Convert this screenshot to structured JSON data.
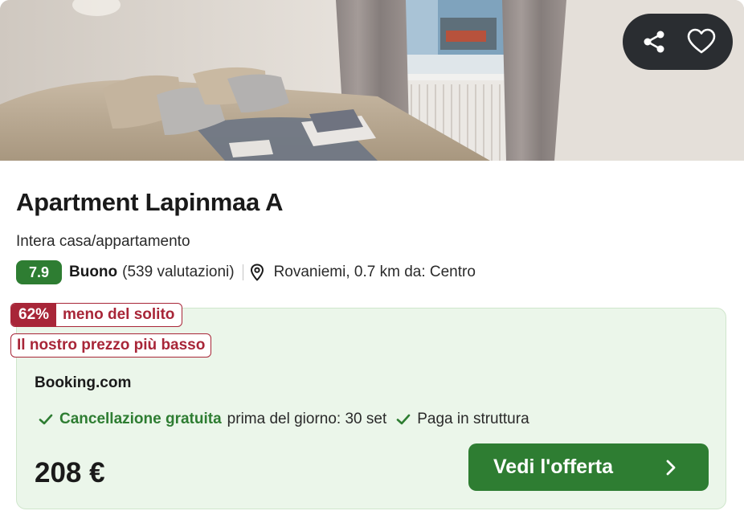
{
  "listing": {
    "title": "Apartment Lapinmaa A",
    "property_type": "Intera casa/appartamento",
    "rating": {
      "score": "7.9",
      "label": "Buono",
      "count": "(539 valutazioni)"
    },
    "location": "Rovaniemi, 0.7 km da: Centro"
  },
  "actions": {
    "share_icon": "share-icon",
    "favorite_icon": "heart-icon"
  },
  "deal": {
    "discount_percent": "62%",
    "discount_text": "meno del solito",
    "lowest_price_badge": "Il nostro prezzo più basso",
    "provider": "Booking.com",
    "perks": {
      "free_cancel": "Cancellazione gratuita",
      "free_cancel_note": "prima del giorno: 30 set",
      "pay_at_property": "Paga in struttura"
    },
    "price": "208 €",
    "cta_label": "Vedi l'offerta"
  },
  "colors": {
    "accent_green": "#2e7d32",
    "deal_background": "#ebf6ea",
    "discount_red": "#a82638",
    "action_pill": "#2a2d31"
  }
}
